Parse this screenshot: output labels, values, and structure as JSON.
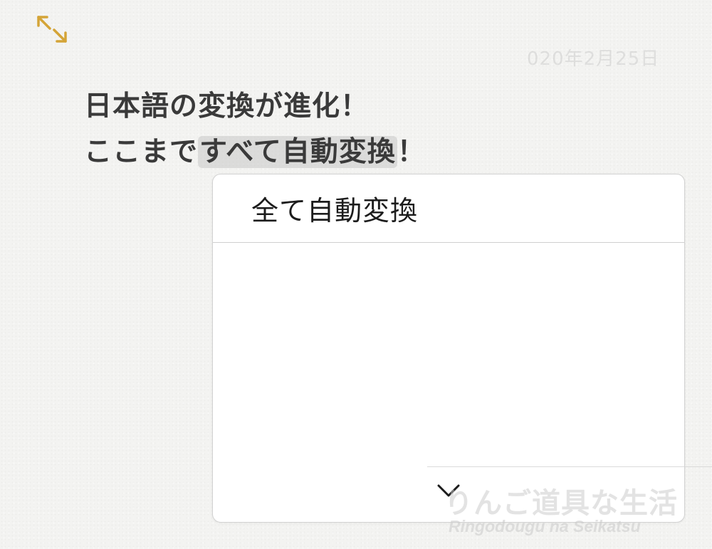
{
  "toolbar": {
    "expand_icon": "expand-arrows-icon",
    "accent_color": "#d4a437"
  },
  "note": {
    "date_hint": "020年2月25日",
    "line1": "日本語の変換が進化！",
    "line2_prefix": "ここまで",
    "line2_marked": "すべて自動変換",
    "line2_suffix": "！"
  },
  "candidates": {
    "items": [
      "全て自動変換"
    ],
    "expand_icon": "chevron-down-icon"
  },
  "watermark": {
    "jp": "りんご道具な生活",
    "en": "Ringodougu na Seikatsu"
  }
}
